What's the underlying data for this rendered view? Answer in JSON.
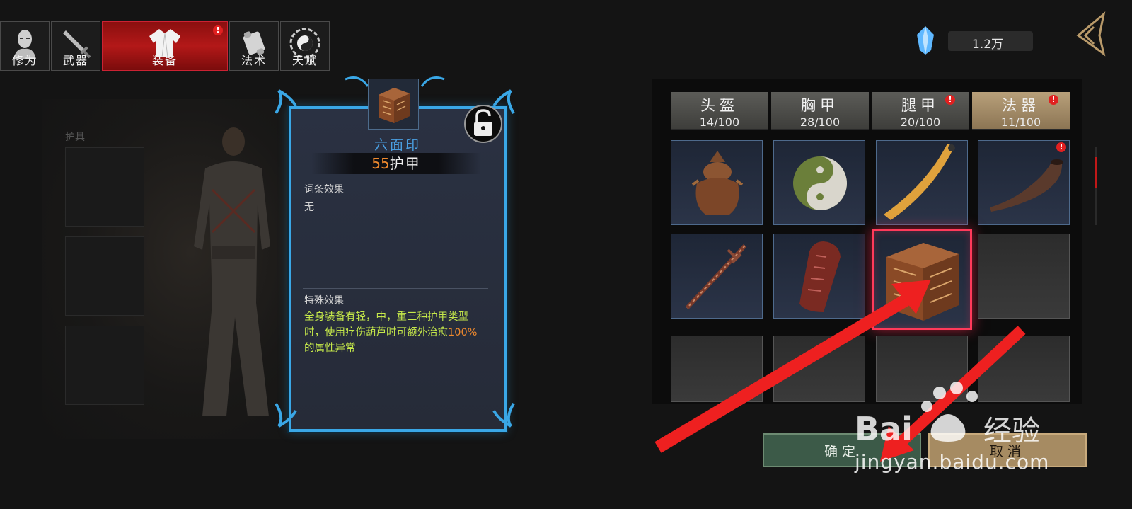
{
  "tabs": [
    {
      "label": "修为",
      "icon": "cultivator-head-icon",
      "badge": false
    },
    {
      "label": "武器",
      "icon": "sword-icon",
      "badge": false
    },
    {
      "label": "装备",
      "icon": "robe-icon",
      "badge": true,
      "active": true
    },
    {
      "label": "法术",
      "icon": "scroll-icon",
      "badge": false
    },
    {
      "label": "天赋",
      "icon": "bagua-icon",
      "badge": false
    }
  ],
  "currency": {
    "icon": "crystal-icon",
    "value": "1.2万"
  },
  "left_panel": {
    "section_label": "护具"
  },
  "item": {
    "name": "六面印",
    "armor_value": "55",
    "armor_unit": "护甲",
    "affix_title": "词条效果",
    "affix_value": "无",
    "special_title": "特殊效果",
    "special_part1": "全身装备有轻，中，重三种护甲类型时，使用疗伤葫芦时可额外治愈",
    "special_highlight": "100%",
    "special_part2": "的属性异常"
  },
  "categories": [
    {
      "name": "头盔",
      "count": "14/100",
      "badge": false
    },
    {
      "name": "胸甲",
      "count": "28/100",
      "badge": false
    },
    {
      "name": "腿甲",
      "count": "20/100",
      "badge": true
    },
    {
      "name": "法器",
      "count": "11/100",
      "badge": true,
      "active": true
    }
  ],
  "inventory": [
    {
      "icon": "bronze-incense-burner-icon"
    },
    {
      "icon": "yin-yang-jade-icon"
    },
    {
      "icon": "wooden-ruler-icon"
    },
    {
      "icon": "horn-icon",
      "badge": true
    },
    {
      "icon": "ornate-sword-icon"
    },
    {
      "icon": "red-talisman-tablet-icon"
    },
    {
      "icon": "six-faced-seal-icon",
      "selected": true
    },
    {
      "icon": "empty-slot"
    },
    {
      "icon": "empty-slot"
    },
    {
      "icon": "empty-slot"
    },
    {
      "icon": "empty-slot"
    },
    {
      "icon": "empty-slot"
    }
  ],
  "buttons": {
    "confirm": "确定",
    "cancel": "取消"
  },
  "watermark": {
    "brand": "Bai du 经验",
    "url": "jingyan.baidu.com"
  },
  "colors": {
    "accent_red": "#b31818",
    "card_border": "#3aa7e6",
    "item_name": "#4a9ee0",
    "highlight_orange": "#f08a2e",
    "special_text": "#c5e84a"
  }
}
